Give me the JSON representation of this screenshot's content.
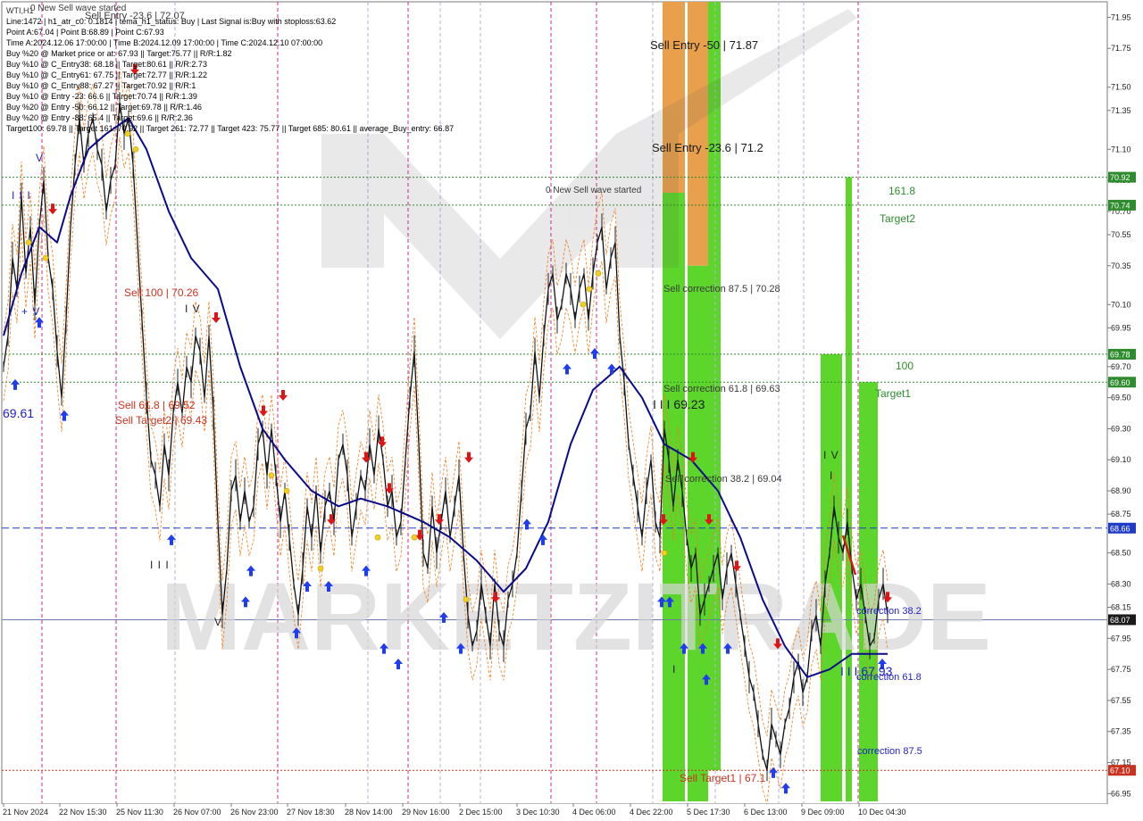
{
  "info_panel": {
    "title": "WTI,H1",
    "lines": [
      "Line:1472 | h1_atr_c0: 0.1814 | tema_h1_status: Buy | Last Signal is:Buy with stoploss:63.62",
      "Point A:67.04 | Point B:68.89 | Point C:67.93",
      "Time A:2024.12.06 17:00:00 | Time B:2024.12.09 17:00:00 | Time C:2024.12.10 07:00:00",
      "Buy %20 @ Market price or at: 67.93 || Target:75.77 || R/R:1.82",
      "Buy %10 @ C_Entry38: 68.18 || Target:80.61 || R/R:2.73",
      "Buy %10 @ C_Entry61: 67.75 || Target:72.77 || R/R:1.22",
      "Buy %10 @ C_Entry88: 67.27 || Target:70.92 || R/R:1",
      "Buy %10 @ Entry -23: 66.6 || Target:70.74 || R/R:1.39",
      "Buy %20 @ Entry -50: 66.12 || Target:69.78 || R/R:1.46",
      "Buy %20 @ Entry -88: 65.4 || Target:69.6 || R/R:2.36",
      "Target100: 69.78 || Target 161: 70.92 || Target 261: 72.77 || Target 423: 75.77 || Target 685: 80.61 || average_Buy_entry: 66.87"
    ]
  },
  "annotations": {
    "new_sell_wave_top": "0 New Sell wave started",
    "sell_entry_top": "Sell Entry -23.6 | 72.07",
    "sell_entry_50": "Sell Entry -50 | 71.87",
    "sell_entry_23": "Sell Entry -23.6 | 71.2",
    "new_sell_wave_mid": "0 New Sell wave started",
    "sell_100": "Sell 100 | 70.26",
    "sell_61": "Sell 61.8 | 69.52",
    "sell_target2": "Sell Target2 | 69.43",
    "sell_corr_875": "Sell correction 87.5 | 70.28",
    "sell_corr_618": "Sell correction 61.8 | 69.63",
    "sell_corr_382": "Sell correction 38.2 | 69.04",
    "wave_6923": "I I I 69.23",
    "wave_6793": "I I I 67.93",
    "fib_1618": "161.8",
    "target2": "Target2",
    "fib_100": "100",
    "target1": "Target1",
    "corr_382": "correction 38.2",
    "corr_618": "correction 61.8",
    "corr_875": "correction 87.5",
    "sell_target1": "Sell Target1 | 67.1",
    "left_price": "69.61",
    "wave_labels": [
      {
        "key": "v1",
        "text": "V"
      },
      {
        "key": "iii1",
        "text": "I I I"
      },
      {
        "key": "iv1",
        "text": "+ V"
      },
      {
        "key": "iv2",
        "text": "I V"
      },
      {
        "key": "iii2",
        "text": "I I I"
      },
      {
        "key": "v2",
        "text": "V"
      },
      {
        "key": "iv3",
        "text": "I V"
      },
      {
        "key": "i1",
        "text": "I"
      },
      {
        "key": "i2",
        "text": "I"
      }
    ]
  },
  "watermark": "MARKETZITRADE",
  "price_tags": [
    {
      "value": "70.92",
      "color": "#2e8b2e"
    },
    {
      "value": "70.74",
      "color": "#2e8b2e"
    },
    {
      "value": "69.78",
      "color": "#2e8b2e"
    },
    {
      "value": "69.60",
      "color": "#2e8b2e"
    },
    {
      "value": "68.66",
      "color": "#1e3cc8"
    },
    {
      "value": "68.07",
      "color": "#1a1a1a"
    },
    {
      "value": "67.10",
      "color": "#c8321e"
    }
  ],
  "chart_data": {
    "type": "line",
    "symbol": "WTI",
    "timeframe": "H1",
    "y_axis": {
      "ticks": [
        "71.95",
        "71.75",
        "71.50",
        "71.35",
        "71.10",
        "70.90",
        "70.70",
        "70.55",
        "70.35",
        "70.10",
        "69.95",
        "69.70",
        "69.50",
        "69.30",
        "69.10",
        "68.90",
        "68.75",
        "68.50",
        "68.30",
        "68.15",
        "67.95",
        "67.75",
        "67.55",
        "67.35",
        "67.15",
        "66.95"
      ],
      "ylim": [
        66.9,
        72.05
      ]
    },
    "x_axis": {
      "ticks": [
        "21 Nov 2024",
        "22 Nov 15:30",
        "25 Nov 11:30",
        "26 Nov 07:00",
        "26 Nov 23:00",
        "27 Nov 18:30",
        "28 Nov 14:00",
        "29 Nov 16:00",
        "2 Dec 15:00",
        "3 Dec 10:30",
        "4 Dec 06:00",
        "4 Dec 22:00",
        "5 Dec 17:30",
        "6 Dec 13:00",
        "9 Dec 09:00",
        "10 Dec 04:30"
      ]
    },
    "price": [
      [
        0,
        69.7
      ],
      [
        5,
        69.9
      ],
      [
        10,
        70.4
      ],
      [
        15,
        70.2
      ],
      [
        20,
        70.8
      ],
      [
        25,
        70.3
      ],
      [
        30,
        70.6
      ],
      [
        35,
        70.1
      ],
      [
        40,
        70.6
      ],
      [
        45,
        70.9
      ],
      [
        50,
        70.4
      ],
      [
        55,
        70.2
      ],
      [
        60,
        69.8
      ],
      [
        65,
        69.5
      ],
      [
        70,
        70.0
      ],
      [
        75,
        70.6
      ],
      [
        80,
        71.0
      ],
      [
        85,
        71.3
      ],
      [
        90,
        71.0
      ],
      [
        95,
        71.2
      ],
      [
        100,
        71.3
      ],
      [
        105,
        71.1
      ],
      [
        110,
        71.0
      ],
      [
        115,
        70.7
      ],
      [
        120,
        70.9
      ],
      [
        125,
        71.0
      ],
      [
        130,
        71.4
      ],
      [
        135,
        71.2
      ],
      [
        140,
        71.3
      ],
      [
        145,
        71.0
      ],
      [
        150,
        70.5
      ],
      [
        155,
        70.0
      ],
      [
        160,
        69.5
      ],
      [
        165,
        69.1
      ],
      [
        170,
        69.0
      ],
      [
        175,
        68.8
      ],
      [
        180,
        69.2
      ],
      [
        185,
        69.0
      ],
      [
        190,
        69.4
      ],
      [
        195,
        69.6
      ],
      [
        200,
        69.4
      ],
      [
        205,
        69.7
      ],
      [
        210,
        69.6
      ],
      [
        215,
        69.9
      ],
      [
        220,
        69.8
      ],
      [
        225,
        69.5
      ],
      [
        230,
        69.9
      ],
      [
        235,
        69.4
      ],
      [
        240,
        68.7
      ],
      [
        245,
        68.1
      ],
      [
        250,
        68.4
      ],
      [
        255,
        68.9
      ],
      [
        260,
        69.0
      ],
      [
        265,
        68.7
      ],
      [
        270,
        68.9
      ],
      [
        275,
        68.7
      ],
      [
        280,
        68.8
      ],
      [
        285,
        69.2
      ],
      [
        290,
        69.3
      ],
      [
        295,
        69.0
      ],
      [
        300,
        69.3
      ],
      [
        305,
        69.0
      ],
      [
        310,
        68.7
      ],
      [
        315,
        68.9
      ],
      [
        320,
        68.6
      ],
      [
        325,
        68.3
      ],
      [
        330,
        68.1
      ],
      [
        335,
        68.4
      ],
      [
        340,
        68.8
      ],
      [
        345,
        68.6
      ],
      [
        350,
        68.9
      ],
      [
        355,
        68.5
      ],
      [
        360,
        68.8
      ],
      [
        365,
        68.9
      ],
      [
        370,
        68.7
      ],
      [
        375,
        69.1
      ],
      [
        380,
        69.2
      ],
      [
        385,
        69.0
      ],
      [
        390,
        68.6
      ],
      [
        395,
        68.8
      ],
      [
        400,
        69.0
      ],
      [
        405,
        68.9
      ],
      [
        410,
        69.2
      ],
      [
        415,
        69.0
      ],
      [
        420,
        69.3
      ],
      [
        425,
        69.1
      ],
      [
        430,
        68.8
      ],
      [
        435,
        68.9
      ],
      [
        440,
        68.6
      ],
      [
        445,
        68.7
      ],
      [
        450,
        69.1
      ],
      [
        455,
        69.5
      ],
      [
        460,
        69.8
      ],
      [
        465,
        69.2
      ],
      [
        470,
        68.5
      ],
      [
        475,
        68.4
      ],
      [
        480,
        68.8
      ],
      [
        485,
        68.5
      ],
      [
        490,
        68.7
      ],
      [
        495,
        68.9
      ],
      [
        500,
        68.6
      ],
      [
        505,
        68.8
      ],
      [
        510,
        69.0
      ],
      [
        515,
        68.5
      ],
      [
        520,
        68.1
      ],
      [
        525,
        67.9
      ],
      [
        530,
        68.0
      ],
      [
        535,
        68.3
      ],
      [
        540,
        68.1
      ],
      [
        545,
        67.9
      ],
      [
        550,
        68.3
      ],
      [
        555,
        68.0
      ],
      [
        560,
        67.9
      ],
      [
        565,
        68.2
      ],
      [
        570,
        68.3
      ],
      [
        575,
        68.5
      ],
      [
        580,
        68.9
      ],
      [
        585,
        69.3
      ],
      [
        590,
        69.4
      ],
      [
        595,
        69.8
      ],
      [
        600,
        69.5
      ],
      [
        605,
        69.9
      ],
      [
        610,
        70.2
      ],
      [
        615,
        70.3
      ],
      [
        620,
        70.0
      ],
      [
        625,
        70.1
      ],
      [
        630,
        70.3
      ],
      [
        635,
        70.2
      ],
      [
        640,
        70.0
      ],
      [
        645,
        70.2
      ],
      [
        650,
        70.3
      ],
      [
        655,
        70.0
      ],
      [
        660,
        70.3
      ],
      [
        665,
        70.5
      ],
      [
        670,
        70.6
      ],
      [
        675,
        70.2
      ],
      [
        680,
        70.4
      ],
      [
        685,
        70.5
      ],
      [
        690,
        69.9
      ],
      [
        695,
        69.6
      ],
      [
        700,
        69.2
      ],
      [
        705,
        69.0
      ],
      [
        710,
        68.8
      ],
      [
        715,
        68.6
      ],
      [
        720,
        68.9
      ],
      [
        725,
        69.1
      ],
      [
        730,
        68.7
      ],
      [
        735,
        68.6
      ],
      [
        740,
        69.3
      ],
      [
        745,
        69.1
      ],
      [
        750,
        68.8
      ],
      [
        755,
        69.1
      ],
      [
        760,
        68.9
      ],
      [
        765,
        68.6
      ],
      [
        770,
        68.4
      ],
      [
        775,
        68.5
      ],
      [
        780,
        68.1
      ],
      [
        785,
        68.2
      ],
      [
        790,
        68.3
      ],
      [
        795,
        68.4
      ],
      [
        800,
        68.5
      ],
      [
        805,
        68.2
      ],
      [
        810,
        68.4
      ],
      [
        815,
        68.5
      ],
      [
        820,
        68.3
      ],
      [
        825,
        68.1
      ],
      [
        830,
        67.9
      ],
      [
        835,
        67.7
      ],
      [
        840,
        67.6
      ],
      [
        845,
        67.4
      ],
      [
        850,
        67.2
      ],
      [
        855,
        67.1
      ],
      [
        860,
        67.4
      ],
      [
        865,
        67.3
      ],
      [
        870,
        67.2
      ],
      [
        875,
        67.4
      ],
      [
        880,
        67.5
      ],
      [
        885,
        67.7
      ],
      [
        890,
        67.8
      ],
      [
        895,
        67.6
      ],
      [
        900,
        67.7
      ],
      [
        905,
        68.0
      ],
      [
        910,
        68.1
      ],
      [
        915,
        67.9
      ],
      [
        920,
        68.3
      ],
      [
        925,
        68.5
      ],
      [
        930,
        68.8
      ],
      [
        935,
        68.6
      ],
      [
        940,
        68.5
      ],
      [
        945,
        68.7
      ],
      [
        950,
        68.4
      ],
      [
        955,
        68.2
      ],
      [
        960,
        68.3
      ],
      [
        965,
        68.1
      ],
      [
        970,
        67.9
      ],
      [
        975,
        67.95
      ],
      [
        980,
        68.2
      ],
      [
        985,
        68.3
      ],
      [
        990,
        68.1
      ]
    ],
    "ma_line": [
      [
        0,
        69.9
      ],
      [
        20,
        70.3
      ],
      [
        40,
        70.6
      ],
      [
        60,
        70.5
      ],
      [
        75,
        70.8
      ],
      [
        95,
        71.1
      ],
      [
        115,
        71.2
      ],
      [
        140,
        71.3
      ],
      [
        160,
        71.1
      ],
      [
        185,
        70.7
      ],
      [
        210,
        70.4
      ],
      [
        240,
        70.2
      ],
      [
        265,
        69.7
      ],
      [
        290,
        69.3
      ],
      [
        315,
        69.1
      ],
      [
        345,
        68.9
      ],
      [
        375,
        68.8
      ],
      [
        400,
        68.85
      ],
      [
        430,
        68.8
      ],
      [
        470,
        68.7
      ],
      [
        500,
        68.6
      ],
      [
        530,
        68.45
      ],
      [
        560,
        68.25
      ],
      [
        585,
        68.4
      ],
      [
        610,
        68.7
      ],
      [
        635,
        69.2
      ],
      [
        660,
        69.55
      ],
      [
        690,
        69.7
      ],
      [
        715,
        69.5
      ],
      [
        740,
        69.2
      ],
      [
        770,
        69.1
      ],
      [
        800,
        68.9
      ],
      [
        825,
        68.6
      ],
      [
        850,
        68.2
      ],
      [
        875,
        67.9
      ],
      [
        900,
        67.7
      ],
      [
        925,
        67.75
      ],
      [
        950,
        67.85
      ],
      [
        975,
        67.85
      ],
      [
        990,
        67.85
      ]
    ],
    "levels": [
      {
        "price": 70.92,
        "color": "#2e8b2e",
        "style": "dotted"
      },
      {
        "price": 70.74,
        "color": "#2e8b2e",
        "style": "dotted"
      },
      {
        "price": 69.78,
        "color": "#2e8b2e",
        "style": "dotted"
      },
      {
        "price": 69.6,
        "color": "#2e8b2e",
        "style": "dotted"
      },
      {
        "price": 68.66,
        "color": "#1e3cc8",
        "style": "dashed"
      },
      {
        "price": 68.07,
        "color": "#6a7ab0",
        "style": "solid"
      },
      {
        "price": 67.1,
        "color": "#c8321e",
        "style": "dotted"
      }
    ],
    "zones": [
      {
        "x0": 742,
        "x1": 767,
        "top": 72.05,
        "bottom": 70.82,
        "color": "#e8a04c"
      },
      {
        "x0": 742,
        "x1": 767,
        "top": 70.82,
        "bottom": 66.9,
        "color": "#5cd62a"
      },
      {
        "x0": 770,
        "x1": 793,
        "top": 72.05,
        "bottom": 70.35,
        "color": "#e8a04c"
      },
      {
        "x0": 770,
        "x1": 793,
        "top": 70.35,
        "bottom": 66.9,
        "color": "#5cd62a"
      },
      {
        "x0": 793,
        "x1": 807,
        "top": 72.05,
        "bottom": 67.1,
        "color": "#5cd62a"
      },
      {
        "x0": 919,
        "x1": 943,
        "top": 69.78,
        "bottom": 66.9,
        "color": "#5cd62a"
      },
      {
        "x0": 947,
        "x1": 954,
        "top": 70.92,
        "bottom": 66.9,
        "color": "#5cd62a"
      },
      {
        "x0": 962,
        "x1": 983,
        "top": 69.6,
        "bottom": 66.9,
        "color": "#5cd62a"
      }
    ],
    "session_lines": [
      {
        "x": 47,
        "color": "#d02a8a"
      },
      {
        "x": 130,
        "color": "#d02a8a"
      },
      {
        "x": 196,
        "color": "#b3b3d9"
      },
      {
        "x": 311,
        "color": "#d02a8a"
      },
      {
        "x": 412,
        "color": "#b3b3d9"
      },
      {
        "x": 457,
        "color": "#d02a8a"
      },
      {
        "x": 493,
        "color": "#b3b3d9"
      },
      {
        "x": 538,
        "color": "#b3b3d9"
      },
      {
        "x": 617,
        "color": "#d02a8a"
      },
      {
        "x": 668,
        "color": "#d02a8a"
      },
      {
        "x": 731,
        "color": "#b3b3d9"
      },
      {
        "x": 801,
        "color": "#b3b3d9"
      },
      {
        "x": 872,
        "color": "#b3b3d9"
      },
      {
        "x": 900,
        "color": "#b3b3d9"
      },
      {
        "x": 961,
        "color": "#d02a8a"
      }
    ],
    "buy_arrows": [
      [
        13,
        69.7
      ],
      [
        40,
        70.1
      ],
      [
        68,
        69.5
      ],
      [
        188,
        68.7
      ],
      [
        271,
        68.3
      ],
      [
        277,
        68.5
      ],
      [
        328,
        68.1
      ],
      [
        340,
        68.4
      ],
      [
        364,
        68.4
      ],
      [
        406,
        68.5
      ],
      [
        426,
        68.0
      ],
      [
        442,
        67.9
      ],
      [
        493,
        68.2
      ],
      [
        512,
        68.0
      ],
      [
        586,
        68.8
      ],
      [
        604,
        68.7
      ],
      [
        631,
        69.8
      ],
      [
        662,
        69.9
      ],
      [
        681,
        69.8
      ],
      [
        737,
        68.3
      ],
      [
        746,
        68.3
      ],
      [
        762,
        68.0
      ],
      [
        783,
        68.0
      ],
      [
        787,
        67.8
      ],
      [
        811,
        68.0
      ],
      [
        862,
        67.2
      ],
      [
        876,
        67.1
      ],
      [
        984,
        67.9
      ]
    ],
    "sell_arrows": [
      [
        55,
        70.6
      ],
      [
        147,
        71.5
      ],
      [
        238,
        69.9
      ],
      [
        291,
        69.3
      ],
      [
        313,
        69.4
      ],
      [
        367,
        68.6
      ],
      [
        406,
        69.0
      ],
      [
        424,
        69.1
      ],
      [
        432,
        68.8
      ],
      [
        466,
        68.5
      ],
      [
        488,
        68.6
      ],
      [
        521,
        69.0
      ],
      [
        551,
        68.1
      ],
      [
        739,
        68.6
      ],
      [
        772,
        69.0
      ],
      [
        790,
        68.6
      ],
      [
        821,
        68.3
      ],
      [
        867,
        67.8
      ],
      [
        990,
        68.1
      ]
    ],
    "stars": [
      [
        28,
        70.5
      ],
      [
        47,
        70.4
      ],
      [
        139,
        71.2
      ],
      [
        148,
        71.1
      ],
      [
        300,
        69.0
      ],
      [
        317,
        68.9
      ],
      [
        355,
        68.4
      ],
      [
        419,
        68.6
      ],
      [
        460,
        68.6
      ],
      [
        518,
        68.2
      ],
      [
        649,
        70.1
      ],
      [
        656,
        70.2
      ],
      [
        666,
        70.3
      ],
      [
        740,
        68.5
      ]
    ]
  }
}
